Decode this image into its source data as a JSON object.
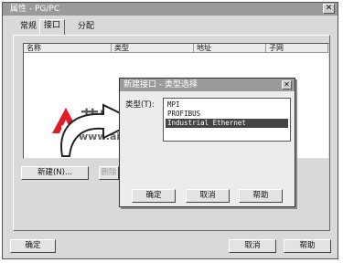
{
  "window": {
    "title": "属性 - PG/PC",
    "close_glyph": "✕"
  },
  "tabs": [
    {
      "label": "常规",
      "active": false
    },
    {
      "label": "接口",
      "active": true
    },
    {
      "label": "分配",
      "active": false
    }
  ],
  "list": {
    "columns": [
      "名称",
      "类型",
      "地址",
      "子网"
    ]
  },
  "panel_buttons": {
    "new": "新建(N)...",
    "delete": "删除"
  },
  "footer": {
    "ok": "确定",
    "cancel": "取消",
    "help": "帮助"
  },
  "dialog": {
    "title": "新建接口 - 类型选择",
    "close_glyph": "✕",
    "type_label": "类型(T):",
    "types": [
      {
        "label": "MPI",
        "selected": false
      },
      {
        "label": "PROFIBUS",
        "selected": false
      },
      {
        "label": "Industrial Ethernet",
        "selected": true
      }
    ],
    "ok": "确定",
    "cancel": "取消",
    "help": "帮助"
  },
  "watermark": {
    "brand": "艾特贸易",
    "url": "www.aitmy.com"
  },
  "colors": {
    "logo_red": "#e01b24",
    "title_bar": "#9a9a9a"
  }
}
